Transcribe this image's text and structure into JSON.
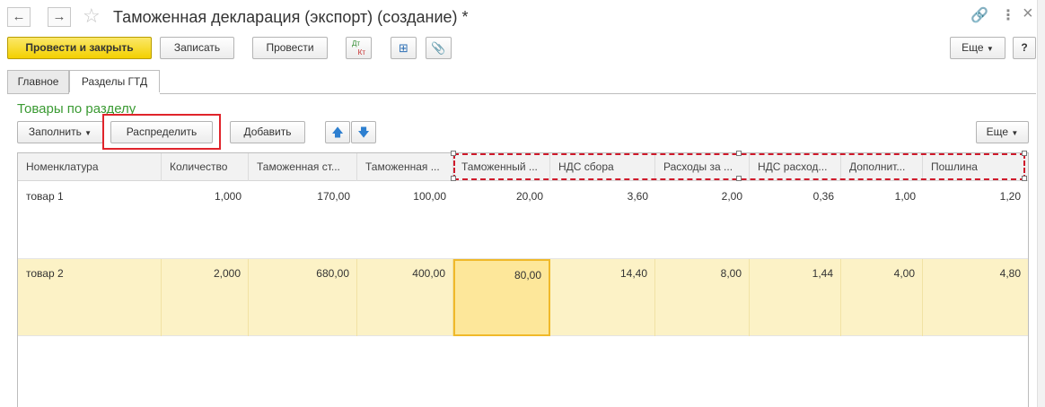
{
  "window": {
    "title": "Таможенная декларация (экспорт) (создание) *",
    "back_icon": "←",
    "forward_icon": "→",
    "star_icon": "☆",
    "link_icon": "🔗",
    "menu_icon": "⋮",
    "close_icon": "×"
  },
  "toolbar": {
    "post_close": "Провести и закрыть",
    "save": "Записать",
    "post": "Провести",
    "dt_kt_top": "Дт",
    "dt_kt_bottom": "Кт",
    "structure_icon": "⊞",
    "attach_icon": "📎",
    "more": "Еще",
    "help": "?"
  },
  "tabs": [
    {
      "label": "Главное",
      "active": false
    },
    {
      "label": "Разделы ГТД",
      "active": true
    }
  ],
  "goods": {
    "group_title": "Товары по разделу",
    "fill": "Заполнить",
    "distribute": "Распределить",
    "add": "Добавить",
    "up_icon": "🡅",
    "down_icon": "🡇",
    "more": "Еще"
  },
  "table": {
    "columns": [
      "Номенклатура",
      "Количество",
      "Таможенная ст...",
      "Таможенная ...",
      "Таможенный ...",
      "НДС сбора",
      "Расходы за ...",
      "НДС расход...",
      "Дополнит...",
      "Пошлина"
    ],
    "rows": [
      [
        "товар 1",
        "1,000",
        "170,00",
        "100,00",
        "20,00",
        "3,60",
        "2,00",
        "0,36",
        "1,00",
        "1,20"
      ],
      [
        "товар 2",
        "2,000",
        "680,00",
        "400,00",
        "80,00",
        "14,40",
        "8,00",
        "1,44",
        "4,00",
        "4,80"
      ]
    ]
  },
  "colors": {
    "accent_green": "#3a9a32",
    "primary_yellow": "#f3d000",
    "highlight_red": "#e0242b",
    "selected_row": "#fcf2c6"
  }
}
